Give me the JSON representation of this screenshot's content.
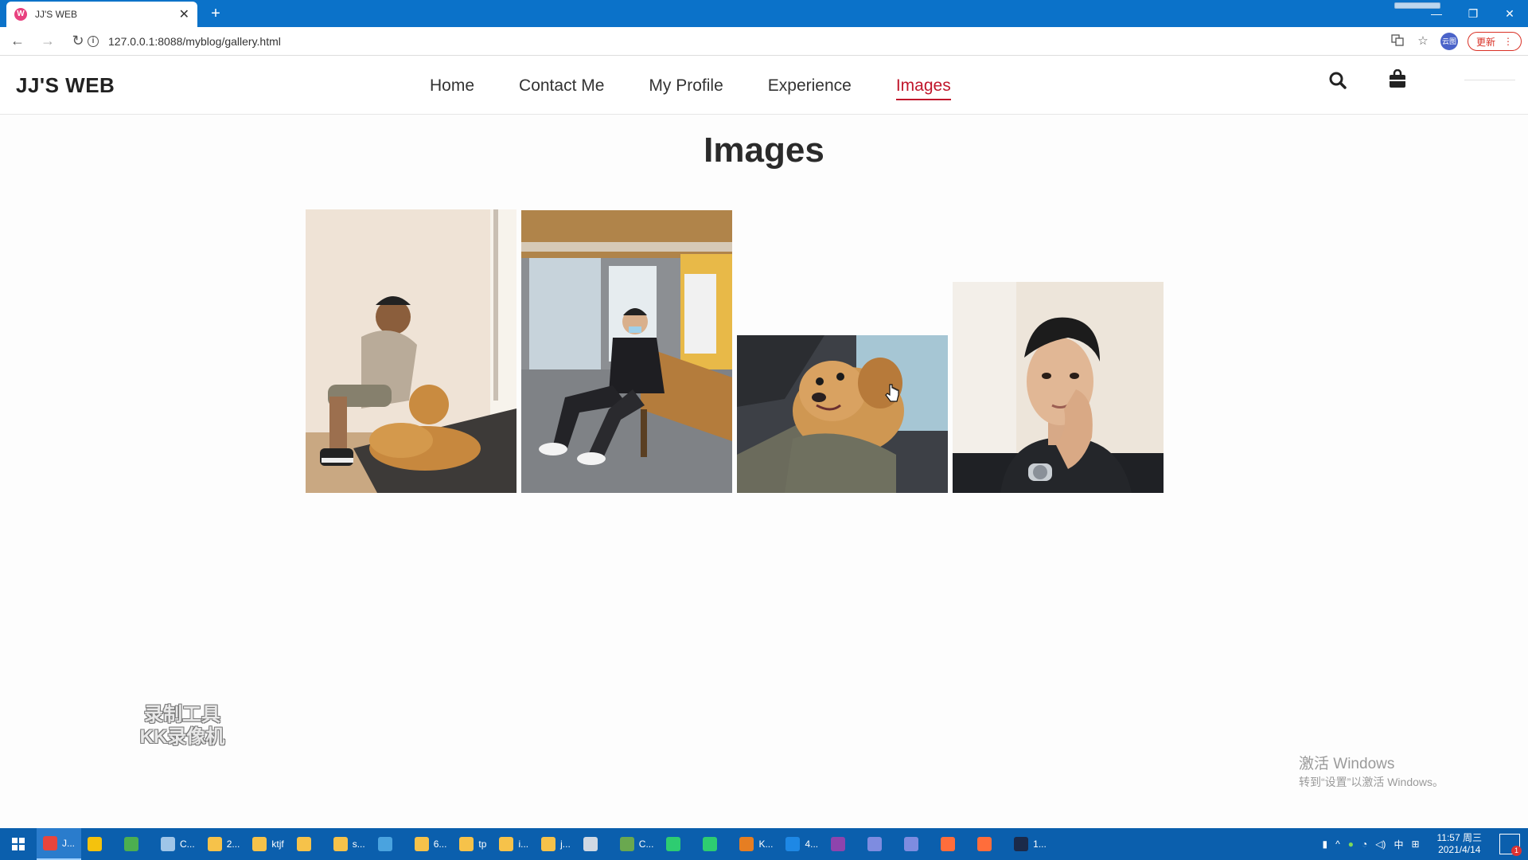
{
  "browser": {
    "tab_title": "JJ'S WEB",
    "tab_favicon_letter": "W",
    "url": "127.0.0.1:8088/myblog/gallery.html",
    "avatar_text": "云图",
    "update_label": "更新"
  },
  "site": {
    "logo": "JJ'S WEB",
    "nav": [
      {
        "label": "Home",
        "active": false
      },
      {
        "label": "Contact Me",
        "active": false
      },
      {
        "label": "My Profile",
        "active": false
      },
      {
        "label": "Experience",
        "active": false
      },
      {
        "label": "Images",
        "active": true
      }
    ],
    "heading": "Images",
    "accent_color": "#c0162b",
    "gallery": [
      {
        "name": "man-with-golden-retriever-photo"
      },
      {
        "name": "man-sitting-on-bench-photo"
      },
      {
        "name": "golden-retriever-in-car-photo"
      },
      {
        "name": "man-selfie-photo"
      }
    ]
  },
  "overlays": {
    "recorder_line1": "录制工具",
    "recorder_line2": "KK录像机",
    "activate_title": "激活 Windows",
    "activate_sub": "转到“设置”以激活 Windows。"
  },
  "taskbar": {
    "items": [
      {
        "label": "J...",
        "color": "#e8453c"
      },
      {
        "label": "",
        "color": "#f4c20d"
      },
      {
        "label": "",
        "color": "#4caf50"
      },
      {
        "label": "C...",
        "color": "#9fc5e8"
      },
      {
        "label": "2...",
        "color": "#f6c24a"
      },
      {
        "label": "ktjf",
        "color": "#f6c24a"
      },
      {
        "label": "",
        "color": "#f6c24a"
      },
      {
        "label": "s...",
        "color": "#f6c24a"
      },
      {
        "label": "",
        "color": "#4aa3df"
      },
      {
        "label": "6...",
        "color": "#f6c24a"
      },
      {
        "label": "tp",
        "color": "#f6c24a"
      },
      {
        "label": "i...",
        "color": "#f6c24a"
      },
      {
        "label": "j...",
        "color": "#f6c24a"
      },
      {
        "label": "",
        "color": "#cfd8e3"
      },
      {
        "label": "C...",
        "color": "#6aa84f"
      },
      {
        "label": "",
        "color": "#2ecc71"
      },
      {
        "label": "",
        "color": "#2ecc71"
      },
      {
        "label": "K...",
        "color": "#e67e22"
      },
      {
        "label": "4...",
        "color": "#1e88e5"
      },
      {
        "label": "",
        "color": "#8e44ad"
      },
      {
        "label": "",
        "color": "#7e8ce0"
      },
      {
        "label": "",
        "color": "#7e8ce0"
      },
      {
        "label": "",
        "color": "#ff6d3b"
      },
      {
        "label": "",
        "color": "#ff6d3b"
      },
      {
        "label": "1...",
        "color": "#1b2a4a"
      }
    ],
    "tray_ime": "中",
    "clock_time": "11:57 周三",
    "clock_date": "2021/4/14",
    "notif_count": "1"
  }
}
